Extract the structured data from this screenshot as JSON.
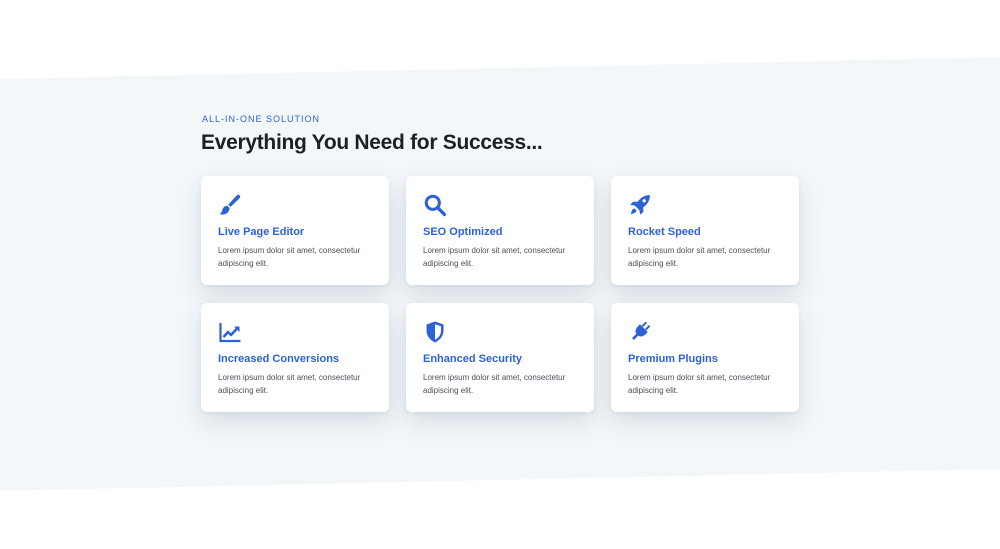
{
  "section": {
    "eyebrow": "ALL-IN-ONE SOLUTION",
    "heading": "Everything You Need for Success..."
  },
  "colors": {
    "accent": "#2d62d6",
    "band": "#f3f7fa",
    "heading": "#1c1f26"
  },
  "features": [
    {
      "icon": "paintbrush-icon",
      "title": "Live Page Editor",
      "description": "Lorem ipsum dolor sit amet, consectetur adipiscing elit."
    },
    {
      "icon": "search-icon",
      "title": "SEO Optimized",
      "description": "Lorem ipsum dolor sit amet, consectetur adipiscing elit."
    },
    {
      "icon": "rocket-icon",
      "title": "Rocket Speed",
      "description": "Lorem ipsum dolor sit amet, consectetur adipiscing elit."
    },
    {
      "icon": "chart-line-icon",
      "title": "Increased Conversions",
      "description": "Lorem ipsum dolor sit amet, consectetur adipiscing elit."
    },
    {
      "icon": "shield-icon",
      "title": "Enhanced Security",
      "description": "Lorem ipsum dolor sit amet, consectetur adipiscing elit."
    },
    {
      "icon": "plug-icon",
      "title": "Premium Plugins",
      "description": "Lorem ipsum dolor sit amet, consectetur adipiscing elit."
    }
  ]
}
